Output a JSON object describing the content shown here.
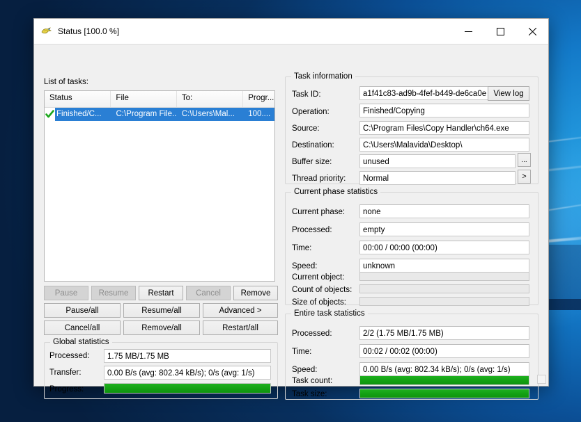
{
  "window": {
    "title": "Status [100.0 %]",
    "icon": "copy-handler-icon",
    "minimize_label": "–",
    "maximize_label": "□",
    "close_label": "✕"
  },
  "colors": {
    "progress_green": "#13a013",
    "selection_blue": "#2a7fd4",
    "window_bg": "#f0f0f0",
    "field_bg": "#ffffff",
    "disabled_text": "#8d8d8d"
  },
  "task_list": {
    "caption": "List of tasks:",
    "columns": [
      "Status",
      "File",
      "To:",
      "Progr..."
    ],
    "rows": [
      {
        "icon": "green-check-icon",
        "status": "Finished/C...",
        "file": "C:\\Program File...",
        "to": "C:\\Users\\Mal...",
        "progress": "100...."
      }
    ]
  },
  "buttons": {
    "row1": [
      {
        "label": "Pause",
        "enabled": false
      },
      {
        "label": "Resume",
        "enabled": false
      },
      {
        "label": "Restart",
        "enabled": true
      },
      {
        "label": "Cancel",
        "enabled": false
      },
      {
        "label": "Remove",
        "enabled": true
      }
    ],
    "row2": [
      {
        "label": "Pause/all",
        "enabled": true
      },
      {
        "label": "Resume/all",
        "enabled": true
      },
      {
        "label": "Advanced >",
        "enabled": true
      }
    ],
    "row3": [
      {
        "label": "Cancel/all",
        "enabled": true
      },
      {
        "label": "Remove/all",
        "enabled": true
      },
      {
        "label": "Restart/all",
        "enabled": true
      }
    ]
  },
  "global_statistics": {
    "title": "Global statistics",
    "processed_label": "Processed:",
    "processed_value": "1.75 MB/1.75 MB",
    "transfer_label": "Transfer:",
    "transfer_value": "0.00 B/s (avg: 802.34 kB/s); 0/s (avg: 1/s)",
    "progress_label": "Progress:",
    "progress_percent": 100
  },
  "task_information": {
    "title": "Task information",
    "task_id_label": "Task ID:",
    "task_id_value": "a1f41c83-ad9b-4fef-b449-de6ca0e",
    "view_log_label": "View log",
    "operation_label": "Operation:",
    "operation_value": "Finished/Copying",
    "source_label": "Source:",
    "source_value": "C:\\Program Files\\Copy Handler\\ch64.exe",
    "destination_label": "Destination:",
    "destination_value": "C:\\Users\\Malavida\\Desktop\\",
    "buffer_size_label": "Buffer size:",
    "buffer_size_value": "unused",
    "buffer_browse_label": "...",
    "thread_priority_label": "Thread priority:",
    "thread_priority_value": "Normal",
    "thread_more_label": ">"
  },
  "current_phase_statistics": {
    "title": "Current phase statistics",
    "current_phase_label": "Current phase:",
    "current_phase_value": "none",
    "processed_label": "Processed:",
    "processed_value": "empty",
    "time_label": "Time:",
    "time_value": "00:00 / 00:00 (00:00)",
    "speed_label": "Speed:",
    "speed_value": "unknown",
    "current_object_label": "Current object:",
    "current_object_percent": 0,
    "count_of_objects_label": "Count of objects:",
    "count_of_objects_percent": 0,
    "size_of_objects_label": "Size of objects:",
    "size_of_objects_percent": 0
  },
  "entire_task_statistics": {
    "title": "Entire task statistics",
    "processed_label": "Processed:",
    "processed_value": "2/2 (1.75 MB/1.75 MB)",
    "time_label": "Time:",
    "time_value": "00:02 / 00:02 (00:00)",
    "speed_label": "Speed:",
    "speed_value": "0.00 B/s (avg: 802.34 kB/s); 0/s (avg: 1/s)",
    "task_count_label": "Task count:",
    "task_count_percent": 100,
    "task_size_label": "Task size:",
    "task_size_percent": 100
  }
}
